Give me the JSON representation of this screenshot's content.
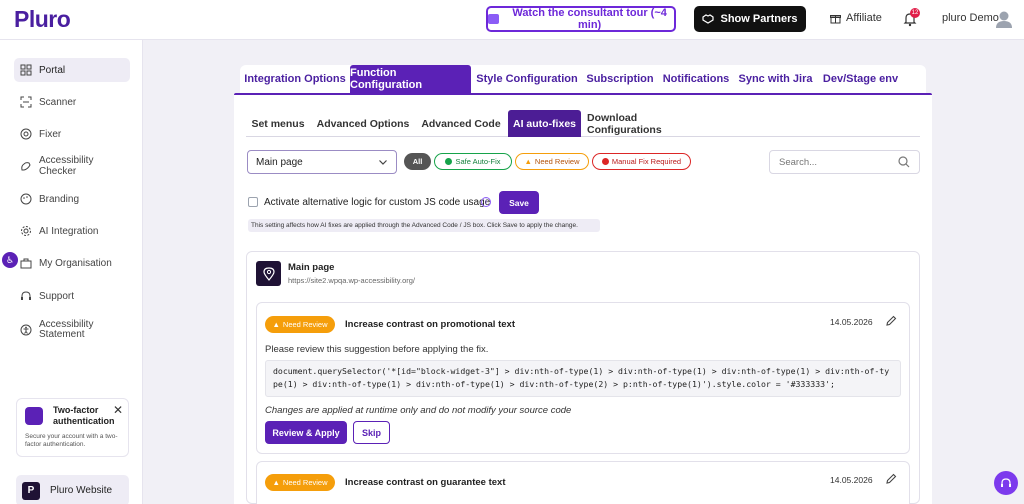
{
  "header": {
    "logo": "Pluro",
    "tour_label": "Watch the consultant tour (~4 min)",
    "partners_label": "Show Partners",
    "affiliate_label": "Affiliate",
    "notification_count": "12",
    "user_name": "pluro Demo"
  },
  "sidebar": {
    "items": [
      {
        "label": "Portal",
        "icon": "grid-icon"
      },
      {
        "label": "Scanner",
        "icon": "scan-icon"
      },
      {
        "label": "Fixer",
        "icon": "fixer-icon"
      },
      {
        "label": "Accessibility Checker",
        "icon": "checker-icon"
      },
      {
        "label": "Branding",
        "icon": "palette-icon"
      },
      {
        "label": "AI Integration",
        "icon": "gear-icon"
      },
      {
        "label": "My Organisation",
        "icon": "briefcase-icon"
      },
      {
        "label": "Support",
        "icon": "headset-icon"
      },
      {
        "label": "Accessibility Statement",
        "icon": "accessibility-icon"
      }
    ],
    "tfa": {
      "title": "Two-factor authentication",
      "description": "Secure your account with a two-factor authentication."
    },
    "website_label": "Pluro Website",
    "website_glyph": "P"
  },
  "tabs": [
    "Integration Options",
    "Function Configuration",
    "Style Configuration",
    "Subscription",
    "Notifications",
    "Sync with Jira",
    "Dev/Stage env"
  ],
  "subtabs": [
    "Set menus",
    "Advanced Options",
    "Advanced Code",
    "AI auto-fixes",
    "Download Configurations"
  ],
  "filters": {
    "page_select": "Main page",
    "chips": [
      "All",
      "Safe Auto-Fix",
      "Need Review",
      "Manual Fix Required"
    ],
    "search_placeholder": "Search..."
  },
  "alt_logic": {
    "label": "Activate alternative logic for custom JS code usage",
    "save_label": "Save",
    "notice": "This setting affects how AI fixes are applied through the Advanced Code / JS box. Click Save to apply the change."
  },
  "site": {
    "name": "Main page",
    "url": "https://site2.wpqa.wp-accessibility.org/"
  },
  "fixes": [
    {
      "badge": "Need Review",
      "title": "Increase contrast on promotional text",
      "date": "14.05.2026",
      "description": "Please review this suggestion before applying the fix.",
      "code": "document.querySelector('*[id=\"block-widget-3\"] > div:nth-of-type(1) > div:nth-of-type(1) > div:nth-of-type(1) > div:nth-of-type(1) > div:nth-of-type(1) > div:nth-of-type(1) > div:nth-of-type(2) > p:nth-of-type(1)').style.color = '#333333';",
      "note": "Changes are applied at runtime only and do not modify your source code",
      "apply_label": "Review & Apply",
      "skip_label": "Skip"
    },
    {
      "badge": "Need Review",
      "title": "Increase contrast on guarantee text",
      "date": "14.05.2026"
    }
  ]
}
